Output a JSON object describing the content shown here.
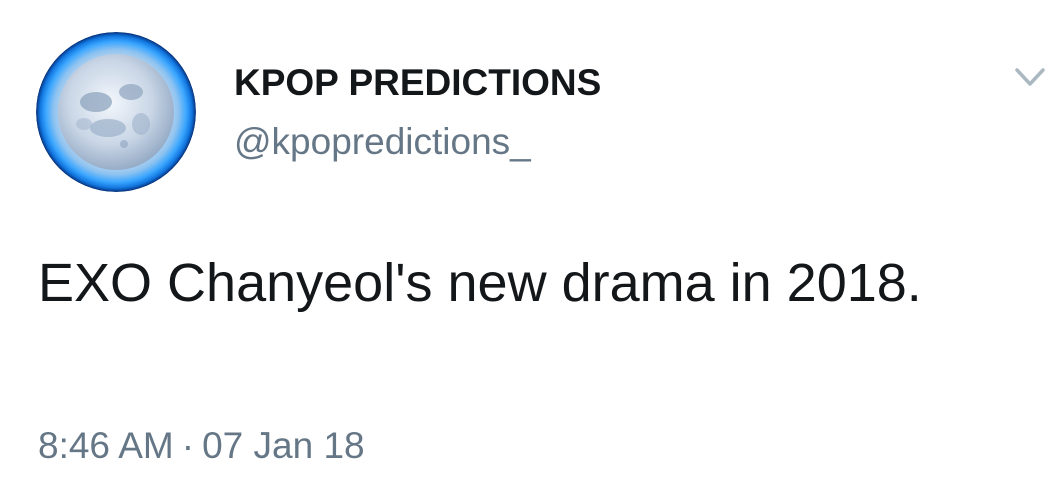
{
  "user": {
    "display_name": "KPOP PREDICTIONS",
    "handle": "@kpopredictions_",
    "avatar_icon": "full-moon-icon"
  },
  "tweet": {
    "text": "EXO Chanyeol's new drama in 2018.",
    "time": "8:46 AM",
    "separator": "·",
    "date": "07 Jan 18"
  },
  "menu": {
    "icon": "chevron-down-icon"
  },
  "colors": {
    "primary_text": "#14171a",
    "secondary_text": "#657786",
    "avatar_glow": "#1e9bff",
    "chevron": "#aab8c2"
  }
}
